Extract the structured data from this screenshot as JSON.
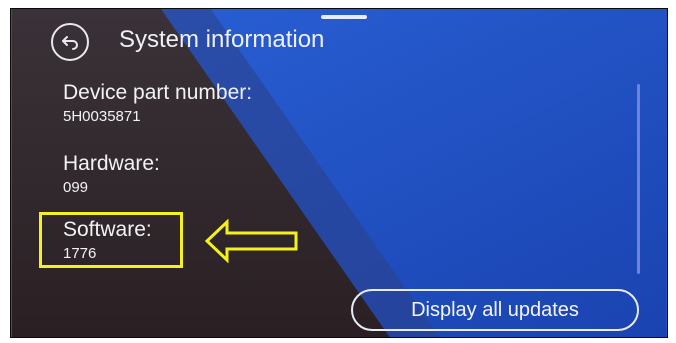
{
  "header": {
    "title": "System information"
  },
  "info": {
    "device_part_label": "Device part number:",
    "device_part_value": "5H0035871",
    "hardware_label": "Hardware:",
    "hardware_value": "099",
    "software_label": "Software:",
    "software_value": "1776"
  },
  "actions": {
    "display_updates_label": "Display all updates"
  },
  "icons": {
    "back": "back-arrow-icon",
    "annotation": "hollow-left-arrow"
  },
  "colors": {
    "screen_blue": "#1f4fc2",
    "dark_overlay": "#2a2530",
    "text": "#f2f2f4",
    "highlight": "#f4f21a"
  }
}
